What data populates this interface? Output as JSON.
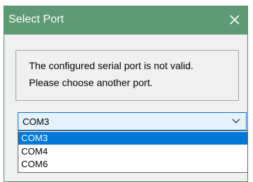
{
  "window": {
    "title": "Select Port"
  },
  "message": {
    "line1": "The configured serial port is not valid.",
    "line2": "Please choose another port."
  },
  "port_select": {
    "selected": "COM3",
    "options": [
      "COM3",
      "COM4",
      "COM6"
    ],
    "highlighted_index": 0
  },
  "icons": {
    "close": "close-icon",
    "dropdown": "chevron-down-icon"
  },
  "colors": {
    "titlebar": "#5e9b74",
    "title_text": "#ffffff",
    "dialog_background": "#f0f0f0",
    "selection": "#0078d7",
    "combo_background": "#e5f1fb"
  }
}
